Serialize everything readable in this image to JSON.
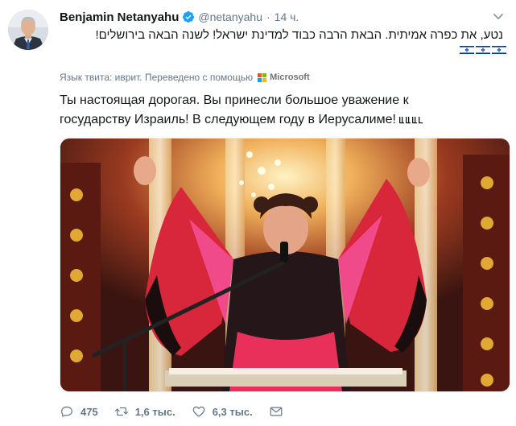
{
  "tweet": {
    "display_name": "Benjamin Netanyahu",
    "handle": "@netanyahu",
    "separator": "·",
    "time": "14 ч.",
    "text_hebrew": "נטע, את כפרה אמיתית. הבאת הרבה כבוד למדינת ישראל! לשנה הבאה בירושלים!",
    "translation_label": "Язык твита: иврит. Переведено с помощью",
    "translator_name": "Microsoft",
    "text_translated": "Ты настоящая дорогая. Вы принесли большое уважение к государству Израиль! В следующем году в Иерусалиме!",
    "flags": [
      "flag-icon",
      "flag-icon",
      "flag-icon"
    ]
  },
  "actions": {
    "replies": "475",
    "retweets": "1,6 тыс.",
    "likes": "6,3 тыс."
  },
  "colors": {
    "verified": "#1da1f2",
    "secondary_text": "#657786",
    "primary_text": "#14171a",
    "flag_blue": "#0038b8"
  },
  "icons": {
    "verified": "verified-badge-icon",
    "caret": "chevron-down-icon",
    "reply": "reply-icon",
    "retweet": "retweet-icon",
    "like": "heart-icon",
    "dm": "envelope-icon",
    "translator_logo": "microsoft-logo-icon"
  }
}
